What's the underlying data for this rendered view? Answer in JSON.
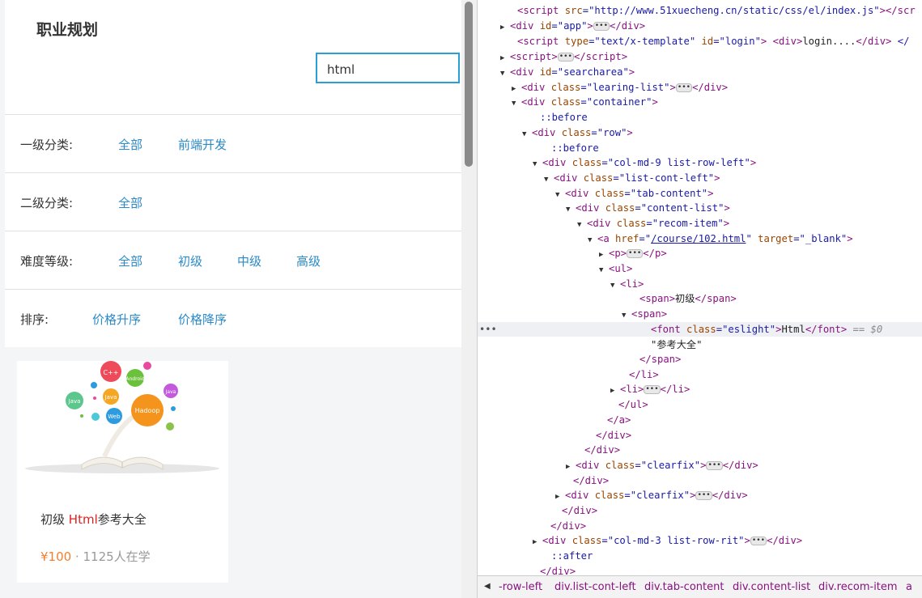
{
  "page": {
    "title": "职业规划",
    "search_value": "html",
    "filters": [
      {
        "label": "一级分类:",
        "options": [
          "全部",
          "前端开发"
        ]
      },
      {
        "label": "二级分类:",
        "options": [
          "全部"
        ]
      },
      {
        "label": "难度等级:",
        "options": [
          "全部",
          "初级",
          "中级",
          "高级"
        ]
      },
      {
        "label": "排序:",
        "options": [
          "价格升序",
          "价格降序"
        ]
      }
    ],
    "course": {
      "level": "初级",
      "highlight": "Html",
      "name_rest": "参考大全",
      "price": "¥100",
      "students": "· 1125人在学",
      "image_labels": [
        "C++",
        "Java",
        "Java",
        "Web",
        "Hadoop",
        "Java",
        "Android"
      ]
    }
  },
  "devtools": {
    "lines": [
      {
        "t": "&lt;script src=\"http://www.51xuecheng.cn/static/css/el/index.js\"&gt;&lt;/scr"
      },
      {
        "t": "&lt;div id=\"app\"&gt;…&lt;/div&gt;"
      },
      {
        "t": "&lt;script type=\"text/x-template\" id=\"login\"&gt; &lt;div&gt;login....&lt;/div&gt; &lt;/"
      },
      {
        "t": "&lt;script&gt;…&lt;/script&gt;"
      },
      {
        "t": "&lt;div id=\"searcharea\"&gt;"
      },
      {
        "t": "&lt;div class=\"learing-list\"&gt;…&lt;/div&gt;"
      },
      {
        "t": "&lt;div class=\"container\"&gt;"
      },
      {
        "t": "::before"
      },
      {
        "t": "&lt;div class=\"row\"&gt;"
      },
      {
        "t": "::before"
      },
      {
        "t": "&lt;div class=\"col-md-9 list-row-left\"&gt;"
      },
      {
        "t": "&lt;div class=\"list-cont-left\"&gt;"
      },
      {
        "t": "&lt;div class=\"tab-content\"&gt;"
      },
      {
        "t": "&lt;div class=\"content-list\"&gt;"
      },
      {
        "t": "&lt;div class=\"recom-item\"&gt;"
      },
      {
        "t": "&lt;a href=\"/course/102.html\" target=\"_blank\"&gt;"
      },
      {
        "t": "&lt;p&gt;…&lt;/p&gt;"
      },
      {
        "t": "&lt;ul&gt;"
      },
      {
        "t": "&lt;li&gt;"
      },
      {
        "t": "&lt;span&gt;初级&lt;/span&gt;"
      },
      {
        "t": "&lt;span&gt;"
      },
      {
        "t": "&lt;font class=\"eslight\"&gt;Html&lt;/font&gt; == $0"
      },
      {
        "t": "\"参考大全\""
      },
      {
        "t": "&lt;/span&gt;"
      },
      {
        "t": "&lt;/li&gt;"
      },
      {
        "t": "&lt;li&gt;…&lt;/li&gt;"
      },
      {
        "t": "&lt;/ul&gt;"
      },
      {
        "t": "&lt;/a&gt;"
      },
      {
        "t": "&lt;/div&gt;"
      },
      {
        "t": "&lt;/div&gt;"
      },
      {
        "t": "&lt;div class=\"clearfix\"&gt;…&lt;/div&gt;"
      },
      {
        "t": "&lt;/div&gt;"
      },
      {
        "t": "&lt;div class=\"clearfix\"&gt;…&lt;/div&gt;"
      },
      {
        "t": "&lt;/div&gt;"
      },
      {
        "t": "&lt;/div&gt;"
      },
      {
        "t": "&lt;div class=\"col-md-3 list-row-rit\"&gt;…&lt;/div&gt;"
      },
      {
        "t": "::after"
      },
      {
        "t": "&lt;/div&gt;"
      }
    ],
    "breadcrumbs": [
      "-row-left",
      "div.list-cont-left",
      "div.tab-content",
      "div.content-list",
      "div.recom-item",
      "a"
    ]
  }
}
